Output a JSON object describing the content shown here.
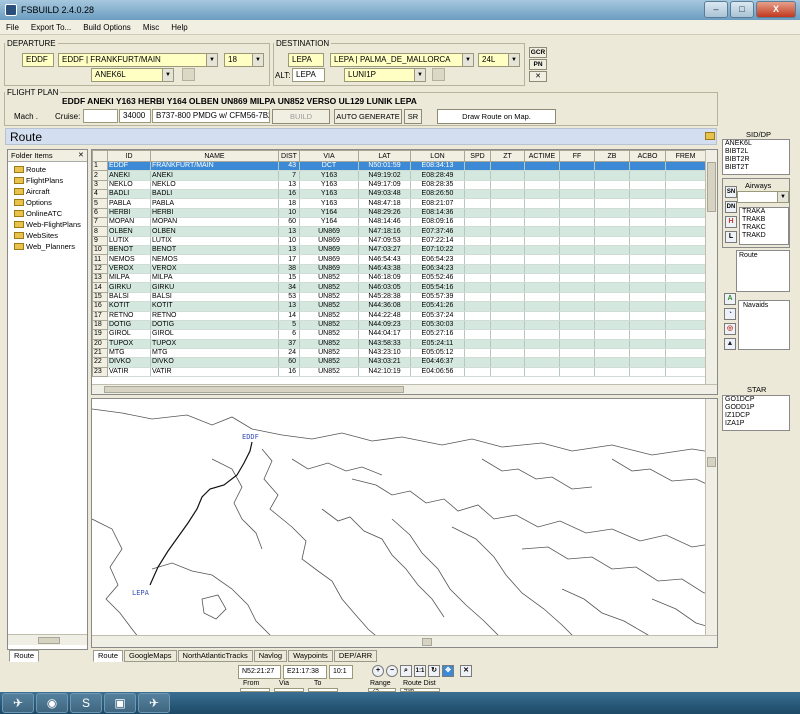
{
  "app": {
    "title": "FSBUILD 2.4.0.28"
  },
  "window_buttons": {
    "minimize": "–",
    "maximize": "□",
    "close": "X"
  },
  "menu": [
    "File",
    "Export To...",
    "Build Options",
    "Misc",
    "Help"
  ],
  "departure": {
    "legend": "DEPARTURE",
    "icao": "EDDF",
    "airport": "EDDF | FRANKFURT/MAIN",
    "runway": "18",
    "sid": "ANEK6L"
  },
  "destination": {
    "legend": "DESTINATION",
    "icao": "LEPA",
    "airport": "LEPA | PALMA_DE_MALLORCA",
    "runway": "24L",
    "alt_label": "ALT:",
    "alt": "LEPA",
    "star": "LUNI1P"
  },
  "side_buttons": {
    "gcr": "GCR",
    "pn": "PN",
    "x": "✕"
  },
  "flight_plan": {
    "legend": "FLIGHT PLAN",
    "route": "EDDF ANEKI Y163 HERBI Y164 OLBEN UN869 MILPA UN852 VERSO UL129 LUNIK LEPA",
    "mach_label": "Mach .",
    "cruise_label": "Cruise:",
    "cruise": "34000",
    "aircraft": "B737-800 PMDG w/ CFM56-7B26",
    "build": "BUILD",
    "auto_generate": "AUTO GENERATE",
    "sr": "SR",
    "draw": "Draw Route on Map."
  },
  "route_title": "Route",
  "folder_panel": {
    "title": "Folder Items",
    "close": "✕",
    "items": [
      "Route",
      "FlightPlans",
      "Aircraft",
      "Options",
      "OnlineATC",
      "Web-FlightPlans",
      "WebSites",
      "Web_Planners"
    ],
    "tab": "Route"
  },
  "table": {
    "columns": [
      "",
      "ID",
      "NAME",
      "DIST",
      "VIA",
      "LAT",
      "LON",
      "SPD",
      "ZT",
      "ACTIME",
      "FF",
      "ZB",
      "ACBO",
      "FREM"
    ],
    "rows": [
      [
        "1",
        "EDDF",
        "FRANKFURT/MAIN",
        "43",
        "DCT",
        "N50:01:59",
        "E08:34:13"
      ],
      [
        "2",
        "ANEKI",
        "ANEKI",
        "7",
        "Y163",
        "N49:19:02",
        "E08:28:49"
      ],
      [
        "3",
        "NEKLO",
        "NEKLO",
        "13",
        "Y163",
        "N49:17:09",
        "E08:28:35"
      ],
      [
        "4",
        "BADLI",
        "BADLI",
        "16",
        "Y163",
        "N49:03:48",
        "E08:26:50"
      ],
      [
        "5",
        "PABLA",
        "PABLA",
        "18",
        "Y163",
        "N48:47:18",
        "E08:21:07"
      ],
      [
        "6",
        "HERBI",
        "HERBI",
        "10",
        "Y164",
        "N48:29:26",
        "E08:14:36"
      ],
      [
        "7",
        "MOPAN",
        "MOPAN",
        "60",
        "Y164",
        "N48:14:46",
        "E08:09:16"
      ],
      [
        "8",
        "OLBEN",
        "OLBEN",
        "13",
        "UN869",
        "N47:18:16",
        "E07:37:46"
      ],
      [
        "9",
        "LUTIX",
        "LUTIX",
        "10",
        "UN869",
        "N47:09:53",
        "E07:22:14"
      ],
      [
        "10",
        "BENOT",
        "BENOT",
        "13",
        "UN869",
        "N47:03:27",
        "E07:10:22"
      ],
      [
        "11",
        "NEMOS",
        "NEMOS",
        "17",
        "UN869",
        "N46:54:43",
        "E06:54:23"
      ],
      [
        "12",
        "VEROX",
        "VEROX",
        "38",
        "UN869",
        "N46:43:38",
        "E06:34:23"
      ],
      [
        "13",
        "MILPA",
        "MILPA",
        "15",
        "UN852",
        "N46:18:09",
        "E05:52:46"
      ],
      [
        "14",
        "GIRKU",
        "GIRKU",
        "34",
        "UN852",
        "N46:03:05",
        "E05:54:16"
      ],
      [
        "15",
        "BALSI",
        "BALSI",
        "53",
        "UN852",
        "N45:28:38",
        "E05:57:39"
      ],
      [
        "16",
        "KOTIT",
        "KOTIT",
        "13",
        "UN852",
        "N44:36:08",
        "E05:41:26"
      ],
      [
        "17",
        "RETNO",
        "RETNO",
        "14",
        "UN852",
        "N44:22:48",
        "E05:37:24"
      ],
      [
        "18",
        "DOTIG",
        "DOTIG",
        "5",
        "UN852",
        "N44:09:23",
        "E05:30:03"
      ],
      [
        "19",
        "GIROL",
        "GIROL",
        "6",
        "UN852",
        "N44:04:17",
        "E05:27:16"
      ],
      [
        "20",
        "TUPOX",
        "TUPOX",
        "37",
        "UN852",
        "N43:58:33",
        "E05:24:11"
      ],
      [
        "21",
        "MTG",
        "MTG",
        "24",
        "UN852",
        "N43:23:10",
        "E05:05:12"
      ],
      [
        "22",
        "DIVKO",
        "DIVKO",
        "60",
        "UN852",
        "N43:03:21",
        "E04:46:37"
      ],
      [
        "23",
        "VATIR",
        "VATIR",
        "16",
        "UN852",
        "N42:10:19",
        "E04:06:56"
      ]
    ]
  },
  "sid_dp": {
    "title": "SID/DP",
    "items": [
      "ANEK6L",
      "BIBT2L",
      "BIBT2R",
      "BIBT2T"
    ]
  },
  "airways": {
    "title": "Airways",
    "items": [
      "TRAKA",
      "TRAKB",
      "TRAKC",
      "TRAKD"
    ],
    "icons": [
      "SN",
      "DN",
      "H",
      "L"
    ]
  },
  "route_box": {
    "title": "Route"
  },
  "navaids": {
    "title": "Navaids",
    "icons": [
      "A",
      "◔",
      "◎",
      "▲"
    ]
  },
  "star": {
    "title": "STAR",
    "items": [
      "GO1DCP",
      "GODD1P",
      "IZ1DCP",
      "IZA1P"
    ]
  },
  "map": {
    "labels": [
      "EDDF",
      "LEPA"
    ],
    "route_color": "#111111"
  },
  "bottom_tabs": [
    "Route",
    "GoogleMaps",
    "NorthAtlanticTracks",
    "Navlog",
    "Waypoints",
    "DEP/ARR"
  ],
  "status": {
    "lat": "N52:21:27",
    "lon": "E21:17:38",
    "zoom": "10:1",
    "from": "From",
    "via": "Via",
    "to": "To",
    "range_label": "Range",
    "range": "25",
    "route_dist_label": "Route Dist",
    "route_dist": "598",
    "q": "Q3"
  },
  "taskbar": [
    "✈",
    "◉",
    "S",
    "▣",
    "✈"
  ]
}
